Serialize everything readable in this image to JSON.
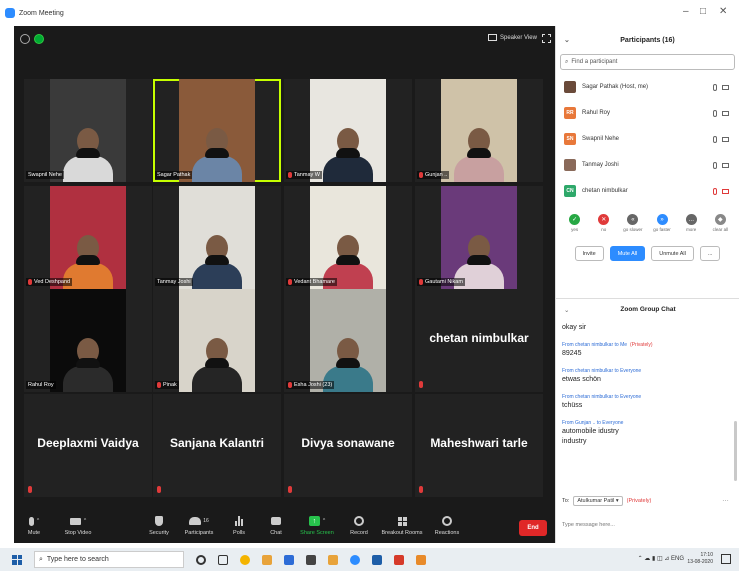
{
  "window": {
    "title": "Zoom Meeting"
  },
  "video": {
    "speaker_view_label": "Speaker View",
    "tiles": [
      {
        "name": "Swapnil Nehe",
        "type": "video",
        "muted": false,
        "bg": "#3a3a3a",
        "shirt": "#d9d9d9"
      },
      {
        "name": "Sagar Pathak",
        "type": "video",
        "muted": false,
        "active": true,
        "bg": "#8a5a3a",
        "shirt": "#6b85a6"
      },
      {
        "name": "Tanmay W",
        "type": "video",
        "muted": true,
        "bg": "#e8e6e0",
        "shirt": "#1f2a3a"
      },
      {
        "name": "Gunjan ..",
        "type": "video",
        "muted": true,
        "bg": "#cfc2a8",
        "shirt": "#c8a0a0"
      },
      {
        "name": "Ved Deshpand",
        "type": "video",
        "muted": true,
        "bg": "#b03040",
        "shirt": "#e07a30"
      },
      {
        "name": "Tanmay Joshi",
        "type": "video",
        "muted": false,
        "bg": "#e0ded8",
        "shirt": "#2c3e58"
      },
      {
        "name": "Vedant Bhamare",
        "type": "video",
        "muted": true,
        "bg": "#e9e6dc",
        "shirt": "#c04050"
      },
      {
        "name": "Gautami Nikam",
        "type": "video",
        "muted": true,
        "bg": "#6a3a7a",
        "shirt": "#e0d0d8"
      },
      {
        "name": "Rahul Roy",
        "type": "video",
        "muted": false,
        "bg": "#0b0b0b",
        "shirt": "#2b2b2b"
      },
      {
        "name": "Pinak",
        "type": "video",
        "muted": true,
        "bg": "#d8d4ca",
        "shirt": "#252525"
      },
      {
        "name": "Esha Joshi (23)",
        "type": "video",
        "muted": true,
        "bg": "#b0b0a8",
        "shirt": "#3a7a8a"
      },
      {
        "name": "chetan nimbulkar",
        "type": "name",
        "muted": true
      },
      {
        "name": "Deeplaxmi Vaidya",
        "type": "name",
        "muted": true
      },
      {
        "name": "Sanjana Kalantri",
        "type": "name",
        "muted": true
      },
      {
        "name": "Divya sonawane",
        "type": "name",
        "muted": true
      },
      {
        "name": "Maheshwari tarle",
        "type": "name",
        "muted": true
      }
    ]
  },
  "toolbar": {
    "mute": "Mute",
    "stop_video": "Stop Video",
    "security": "Security",
    "participants": "Participants",
    "participants_count": "16",
    "polls": "Polls",
    "chat": "Chat",
    "share_screen": "Share Screen",
    "record": "Record",
    "breakout_rooms": "Breakout Rooms",
    "reactions": "Reactions",
    "end": "End"
  },
  "participants_panel": {
    "title": "Participants (16)",
    "search_placeholder": "Find a participant",
    "rows": [
      {
        "name": "Sagar Pathak (Host, me)",
        "initials": "",
        "color": "#6a4a3a",
        "mic_off": false,
        "cam_off": false
      },
      {
        "name": "Rahul Roy",
        "initials": "RR",
        "color": "#e8783a",
        "mic_off": false,
        "cam_off": false
      },
      {
        "name": "Swapnil Nehe",
        "initials": "SN",
        "color": "#e8783a",
        "mic_off": false,
        "cam_off": false
      },
      {
        "name": "Tanmay Joshi",
        "initials": "",
        "color": "#8a6a5a",
        "mic_off": false,
        "cam_off": false
      },
      {
        "name": "chetan nimbulkar",
        "initials": "CN",
        "color": "#2ea86a",
        "mic_off": true,
        "cam_off": true
      }
    ],
    "reactions": [
      {
        "label": "yes",
        "color": "#27a844",
        "glyph": "✓"
      },
      {
        "label": "no",
        "color": "#e03a3a",
        "glyph": "✕"
      },
      {
        "label": "go slower",
        "color": "#666666",
        "glyph": "«"
      },
      {
        "label": "go faster",
        "color": "#2d8cff",
        "glyph": "»"
      },
      {
        "label": "more",
        "color": "#666666",
        "glyph": "…"
      },
      {
        "label": "clear all",
        "color": "#888888",
        "glyph": "◆"
      }
    ],
    "invite": "Invite",
    "mute_all": "Mute All",
    "unmute_all": "Unmute All",
    "more": "..."
  },
  "chat": {
    "title": "Zoom Group Chat",
    "messages": [
      {
        "from": "",
        "privately": "",
        "text": "okay sir"
      },
      {
        "from": "From chetan nimbulkar to Me",
        "privately": "(Privately)",
        "text": "89245"
      },
      {
        "from": "From chetan nimbulkar to Everyone",
        "privately": "",
        "text": "etwas schön"
      },
      {
        "from": "From chetan nimbulkar to Everyone",
        "privately": "",
        "text": "tchüss"
      },
      {
        "from": "From Gunjan .. to Everyone",
        "privately": "",
        "text": "automobile idustry\nindustry"
      }
    ],
    "to_label": "To:",
    "to_value": "Atulkumar Patil ▾",
    "to_privately": "(Privately)",
    "input_placeholder": "Type message here..."
  },
  "taskbar": {
    "search_placeholder": "Type here to search",
    "lang": "ENG",
    "time": "17:10",
    "date": "13-08-2020"
  }
}
